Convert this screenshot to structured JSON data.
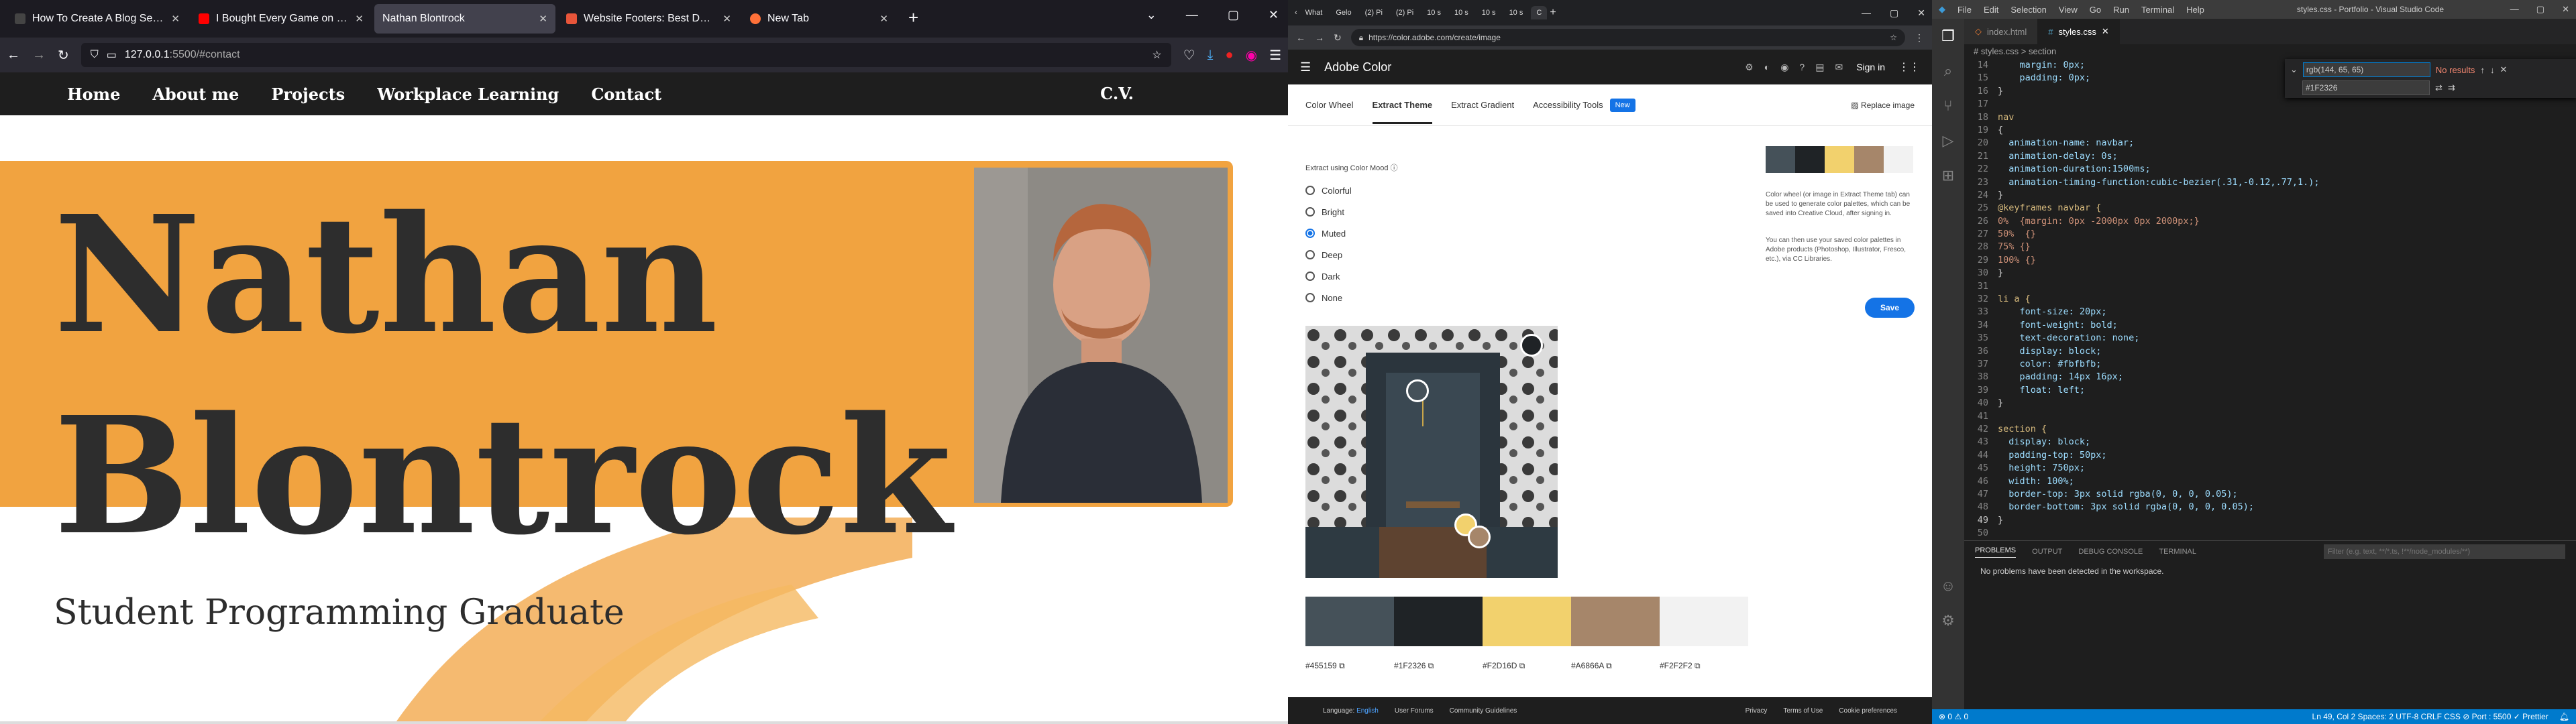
{
  "firefox": {
    "tabs": [
      {
        "label": "How To Create A Blog Section",
        "color": "#444444"
      },
      {
        "label": "I Bought Every Game on Steam",
        "color": "#ff0000"
      },
      {
        "label": "Nathan Blontrock",
        "color": "#42414d",
        "active": true
      },
      {
        "label": "Website Footers: Best Design Pr",
        "color": "#e8553a"
      },
      {
        "label": "New Tab",
        "color": "#ff7139"
      }
    ],
    "url": "127.0.0.1:5500/#contact",
    "url_dim": ":5500/#contact",
    "url_host": "127.0.0.1"
  },
  "site": {
    "nav": [
      "Home",
      "About me",
      "Projects",
      "Workplace Learning",
      "Contact"
    ],
    "cv": "C.V.",
    "first_name": "Nathan",
    "last_name": "Blontrock",
    "subtitle": "Student Programming Graduate"
  },
  "chrome": {
    "tabs": [
      "What",
      "Gelo",
      "(2) Pi",
      "(2) Pi",
      "10 s",
      "10 s",
      "10 s",
      "10 s",
      "C"
    ],
    "url": "https://color.adobe.com/create/image"
  },
  "adobe": {
    "app_name": "Adobe Color",
    "signin": "Sign in",
    "tabs": [
      "Color Wheel",
      "Extract Theme",
      "Extract Gradient",
      "Accessibility Tools"
    ],
    "new_badge": "New",
    "replace": "Replace image",
    "mood_label": "Extract using Color Mood",
    "moods": [
      "Colorful",
      "Bright",
      "Muted",
      "Deep",
      "Dark",
      "None"
    ],
    "selected_mood": "Muted",
    "info1": "Color wheel (or image in Extract Theme tab) can be used to generate color palettes, which can be saved into Creative Cloud, after signing in.",
    "info2": "You can then use your saved color palettes in Adobe products (Photoshop, Illustrator, Fresco, etc.), via CC Libraries.",
    "save": "Save",
    "swatches": [
      {
        "hex": "#455159",
        "color": "#455159"
      },
      {
        "hex": "#1F2326",
        "color": "#1f2326"
      },
      {
        "hex": "#F2D16D",
        "color": "#f2d16d"
      },
      {
        "hex": "#A6866A",
        "color": "#a6866a"
      },
      {
        "hex": "#F2F2F2",
        "color": "#f2f2f2"
      }
    ],
    "footer": {
      "language_label": "Language:",
      "language": "English",
      "links": [
        "User Forums",
        "Community Guidelines",
        "Privacy",
        "Terms of Use",
        "Cookie preferences"
      ]
    }
  },
  "vscode": {
    "menu": [
      "File",
      "Edit",
      "Selection",
      "View",
      "Go",
      "Run",
      "Terminal",
      "Help"
    ],
    "title": "styles.css - Portfolio - Visual Studio Code",
    "tabs": [
      "index.html",
      "styles.css"
    ],
    "breadcrumb": "# styles.css > section",
    "find_value": "rgb(144, 65, 65)",
    "find_results": "No results",
    "replace_value": "#1F2326",
    "code_lines": [
      {
        "n": "14",
        "t": "    margin: 0px;"
      },
      {
        "n": "15",
        "t": "    padding: 0px;"
      },
      {
        "n": "16",
        "t": "}"
      },
      {
        "n": "17",
        "t": ""
      },
      {
        "n": "18",
        "t": "nav"
      },
      {
        "n": "19",
        "t": "{"
      },
      {
        "n": "20",
        "t": "  animation-name: navbar;"
      },
      {
        "n": "21",
        "t": "  animation-delay: 0s;"
      },
      {
        "n": "22",
        "t": "  animation-duration:1500ms;"
      },
      {
        "n": "23",
        "t": "  animation-timing-function:cubic-bezier(.31,-0.12,.77,1.);"
      },
      {
        "n": "24",
        "t": "}"
      },
      {
        "n": "25",
        "t": "@keyframes navbar {"
      },
      {
        "n": "26",
        "t": "0%  {margin: 0px -2000px 0px 2000px;}"
      },
      {
        "n": "27",
        "t": "50%  {}"
      },
      {
        "n": "28",
        "t": "75% {}"
      },
      {
        "n": "29",
        "t": "100% {}"
      },
      {
        "n": "30",
        "t": "}"
      },
      {
        "n": "31",
        "t": ""
      },
      {
        "n": "32",
        "t": "li a {"
      },
      {
        "n": "33",
        "t": "    font-size: 20px;"
      },
      {
        "n": "34",
        "t": "    font-weight: bold;"
      },
      {
        "n": "35",
        "t": "    text-decoration: none;"
      },
      {
        "n": "36",
        "t": "    display: block;"
      },
      {
        "n": "37",
        "t": "    color: #fbfbfb;"
      },
      {
        "n": "38",
        "t": "    padding: 14px 16px;"
      },
      {
        "n": "39",
        "t": "    float: left;"
      },
      {
        "n": "40",
        "t": "}"
      },
      {
        "n": "41",
        "t": ""
      },
      {
        "n": "42",
        "t": "section {"
      },
      {
        "n": "43",
        "t": "  display: block;"
      },
      {
        "n": "44",
        "t": "  padding-top: 50px;"
      },
      {
        "n": "45",
        "t": "  height: 750px;"
      },
      {
        "n": "46",
        "t": "  width: 100%;"
      },
      {
        "n": "47",
        "t": "  border-top: 3px solid rgba(0, 0, 0, 0.05);"
      },
      {
        "n": "48",
        "t": "  border-bottom: 3px solid rgba(0, 0, 0, 0.05);"
      },
      {
        "n": "49",
        "t": "}"
      },
      {
        "n": "50",
        "t": ""
      }
    ],
    "panel_tabs": [
      "PROBLEMS",
      "OUTPUT",
      "DEBUG CONSOLE",
      "TERMINAL"
    ],
    "panel_filter": "Filter (e.g. text, **/*.ts, !**/node_modules/**)",
    "panel_message": "No problems have been detected in the workspace.",
    "status_left": "⊗ 0 ⚠ 0",
    "status_right": "Ln 49, Col 2   Spaces: 2   UTF-8   CRLF   CSS   ⊘ Port : 5500   ✓ Prettier"
  }
}
